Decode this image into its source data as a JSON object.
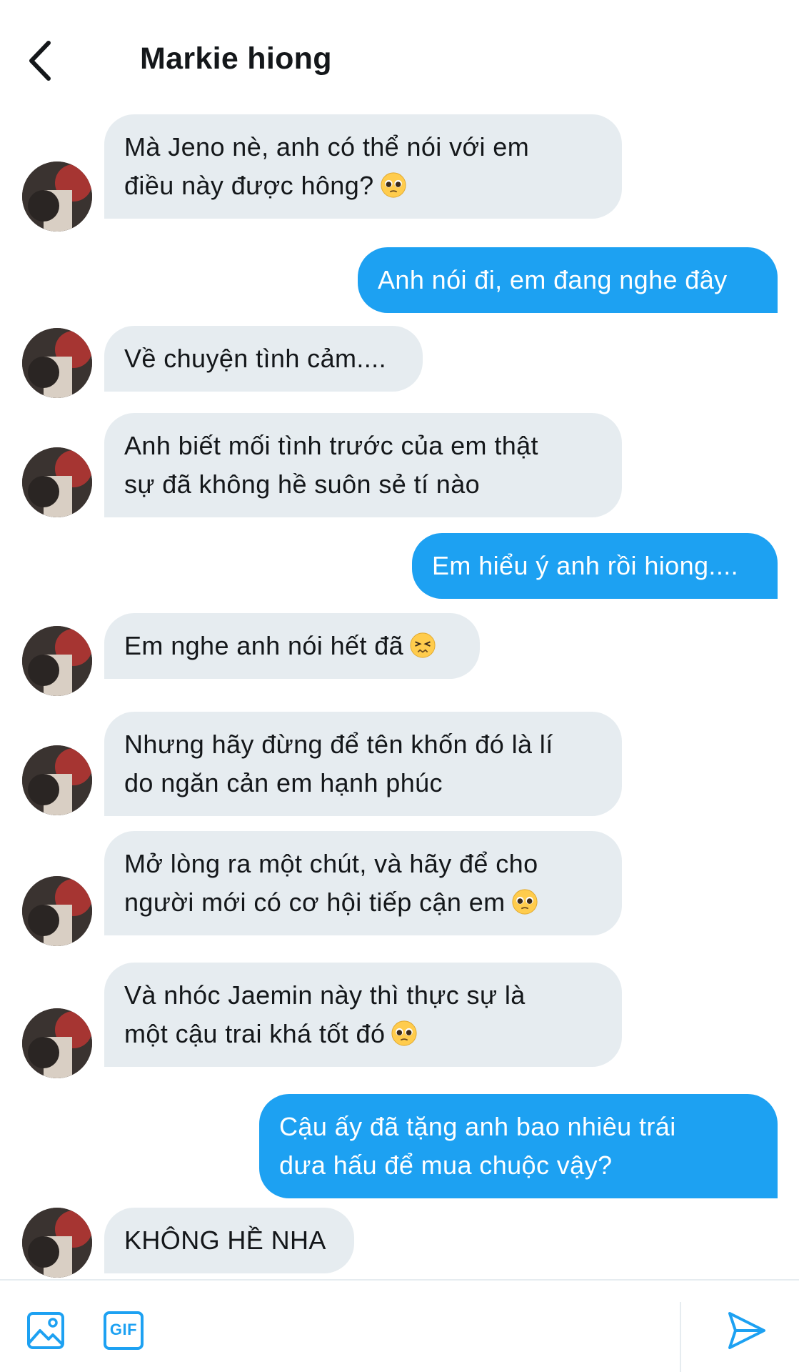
{
  "header": {
    "title": "Markie hiong",
    "back_icon": "chevron-left-icon"
  },
  "messages": [
    {
      "from": "them",
      "lines": [
        "Mà Jeno nè, anh có thể nói với em",
        "điều này được hông?"
      ],
      "emoji": "pleading-face-icon"
    },
    {
      "from": "me",
      "lines": [
        "Anh nói đi, em đang nghe đây"
      ]
    },
    {
      "from": "them",
      "lines": [
        "Về chuyện tình cảm...."
      ]
    },
    {
      "from": "them",
      "lines": [
        "Anh biết mối tình trước của em thật",
        "sự đã không hề suôn sẻ tí nào"
      ]
    },
    {
      "from": "me",
      "lines": [
        "Em hiểu ý anh rồi hiong...."
      ]
    },
    {
      "from": "them",
      "lines": [
        "Em nghe anh nói hết đã"
      ],
      "emoji": "persevering-face-icon"
    },
    {
      "from": "them",
      "lines": [
        "Nhưng hãy đừng để tên khốn đó là lí",
        "do ngăn cản em hạnh phúc"
      ]
    },
    {
      "from": "them",
      "lines": [
        "Mở lòng ra một chút, và hãy để cho",
        "người mới có cơ hội tiếp cận em"
      ],
      "emoji": "pleading-face-icon"
    },
    {
      "from": "them",
      "lines": [
        "Và nhóc Jaemin này thì thực sự là",
        "một cậu trai khá tốt đó"
      ],
      "emoji": "pleading-face-icon"
    },
    {
      "from": "me",
      "lines": [
        "Cậu ấy đã tặng anh bao nhiêu trái",
        "dưa hấu để mua chuộc vậy?"
      ]
    },
    {
      "from": "them",
      "lines": [
        "KHÔNG HỀ NHA"
      ]
    }
  ],
  "composer": {
    "image_icon": "image-icon",
    "gif_label": "GIF",
    "send_icon": "send-icon"
  },
  "colors": {
    "incoming_bubble": "#e6ecf0",
    "outgoing_bubble": "#1da1f2",
    "accent": "#1da1f2"
  }
}
